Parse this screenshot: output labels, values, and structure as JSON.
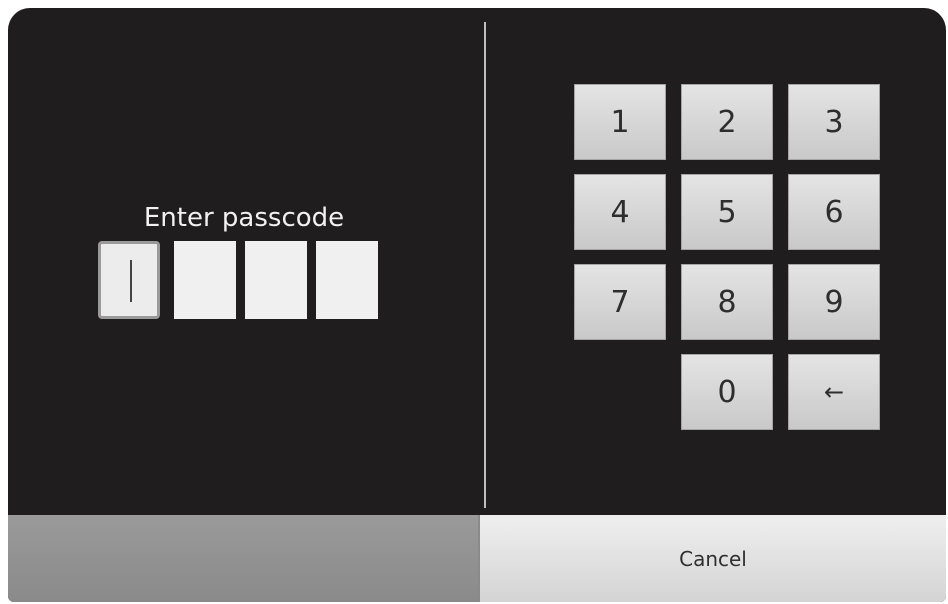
{
  "prompt": "Enter passcode",
  "passcode": {
    "digits": [
      "",
      "",
      "",
      ""
    ],
    "active_index": 0
  },
  "keypad": {
    "keys": [
      "1",
      "2",
      "3",
      "4",
      "5",
      "6",
      "7",
      "8",
      "9",
      "0",
      "←"
    ],
    "backspace_icon": "left-arrow-icon"
  },
  "actions": {
    "cancel_label": "Cancel"
  },
  "colors": {
    "dialog_background": "#1f1d1e",
    "key_background": "#d6d6d6",
    "bottom_bar": "#8f8f8f"
  }
}
